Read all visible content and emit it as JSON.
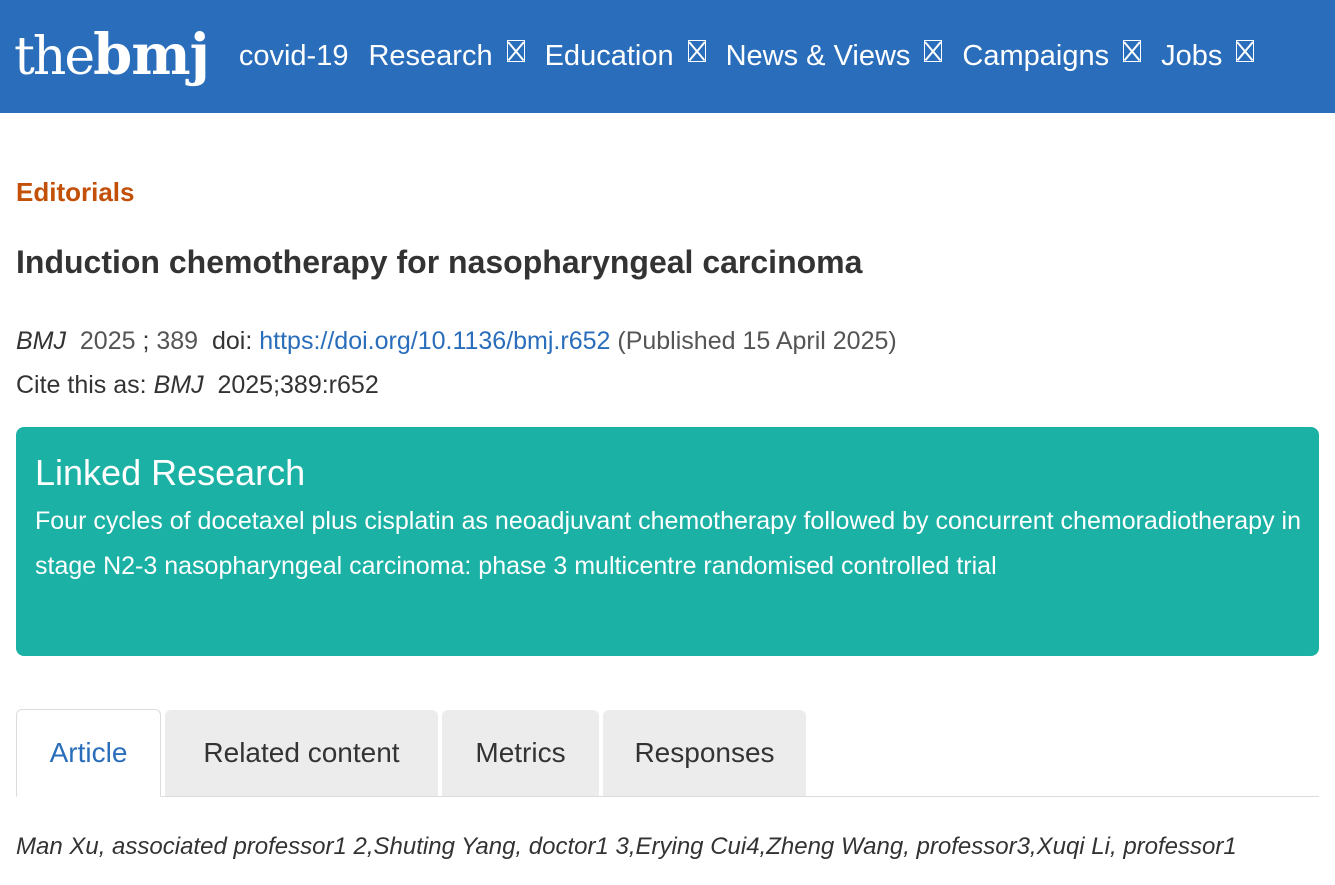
{
  "header": {
    "logo_the": "the",
    "logo_bmj": "bmj",
    "nav": [
      {
        "label": "covid-19",
        "has_dropdown": false
      },
      {
        "label": "Research",
        "has_dropdown": true
      },
      {
        "label": "Education",
        "has_dropdown": true
      },
      {
        "label": "News & Views",
        "has_dropdown": true
      },
      {
        "label": "Campaigns",
        "has_dropdown": true
      },
      {
        "label": "Jobs",
        "has_dropdown": true
      }
    ]
  },
  "article": {
    "section": "Editorials",
    "title": "Induction chemotherapy for nasopharyngeal carcinoma",
    "journal": "BMJ",
    "year": "2025",
    "volume": "389",
    "doi_label": "doi:",
    "doi_url": "https://doi.org/10.1136/bmj.r652",
    "published": "(Published 15 April 2025)",
    "cite_label": "Cite this as:",
    "cite_value": "2025;389:r652"
  },
  "linked": {
    "heading": "Linked Research",
    "text": "Four cycles of docetaxel plus cisplatin as neoadjuvant chemotherapy followed by concurrent chemoradiotherapy in stage N2-3 nasopharyngeal carcinoma: phase 3 multicentre randomised controlled trial"
  },
  "tabs": [
    {
      "label": "Article",
      "active": true
    },
    {
      "label": "Related content",
      "active": false
    },
    {
      "label": "Metrics",
      "active": false
    },
    {
      "label": "Responses",
      "active": false
    }
  ],
  "authors": "Man Xu, associated professor1 2,Shuting Yang, doctor1 3,Erying Cui4,Zheng Wang, professor3,Xuqi Li, professor1",
  "colors": {
    "header_bg": "#2a6ebb",
    "section_label": "#c25009",
    "linked_bg": "#1bb1a5",
    "link": "#2a6ebb"
  }
}
